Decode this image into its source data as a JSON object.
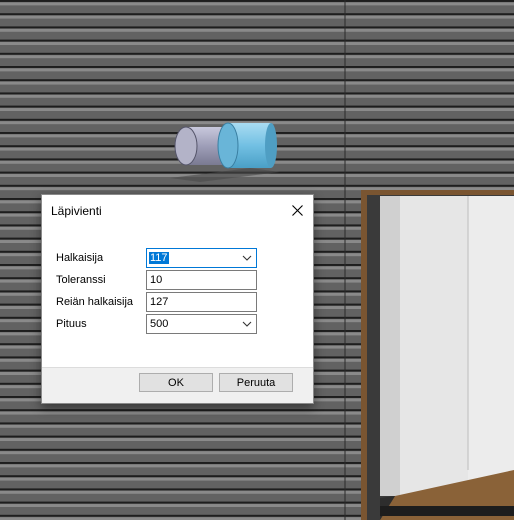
{
  "dialog": {
    "title": "Läpivienti",
    "fields": [
      {
        "label": "Halkaisija",
        "value": "117",
        "type": "combobox",
        "selected": true
      },
      {
        "label": "Toleranssi",
        "value": "10",
        "type": "text"
      },
      {
        "label": "Reiän halkaisija",
        "value": "127",
        "type": "text"
      },
      {
        "label": "Pituus",
        "value": "500",
        "type": "combobox"
      }
    ],
    "ok_label": "OK",
    "cancel_label": "Peruuta"
  },
  "colors": {
    "accent": "#0078d7",
    "siding": "#5c5c5c",
    "pipe": "#7fc6e6",
    "floor": "#8a6238"
  },
  "icons": [
    "close-icon",
    "chevron-down-icon"
  ]
}
